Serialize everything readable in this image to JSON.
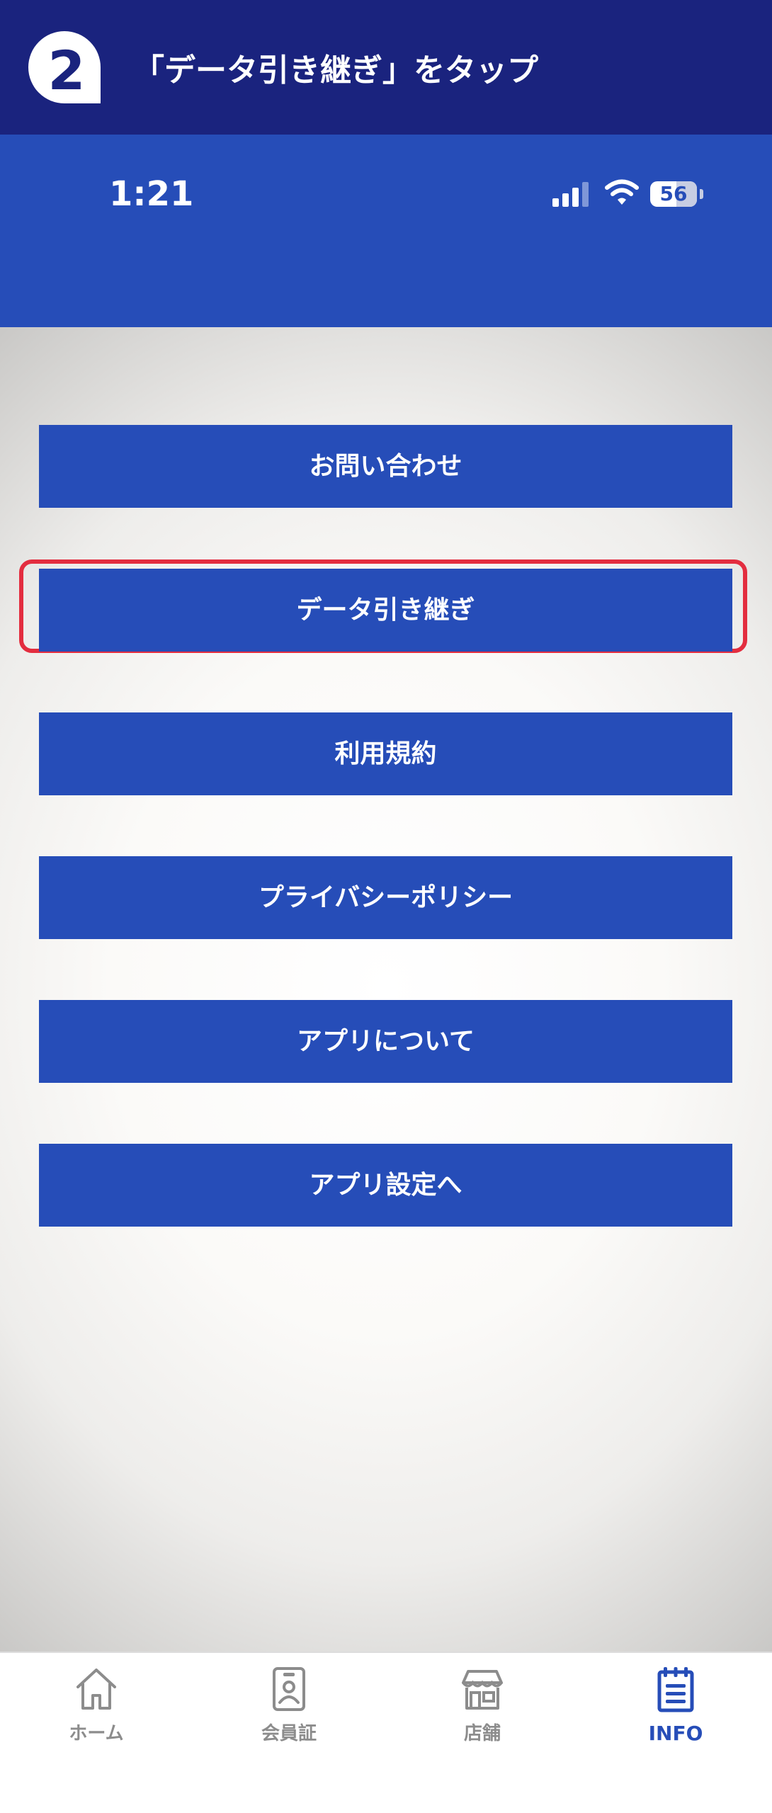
{
  "instruction_banner": {
    "title": "「データ引き継ぎ」をタップ",
    "logo_text": "2"
  },
  "status_bar": {
    "time": "1:21",
    "battery_level": "56",
    "icons": [
      "cellular-signal-icon",
      "wifi-icon",
      "battery-icon"
    ]
  },
  "menu": {
    "items": [
      {
        "label": "お問い合わせ"
      },
      {
        "label": "データ引き継ぎ",
        "highlighted": true
      },
      {
        "label": "利用規約"
      },
      {
        "label": "プライバシーポリシー"
      },
      {
        "label": "アプリについて"
      },
      {
        "label": "アプリ設定へ"
      }
    ]
  },
  "tab_bar": {
    "tabs": [
      {
        "label": "ホーム",
        "icon": "home-icon"
      },
      {
        "label": "会員証",
        "icon": "member-card-icon"
      },
      {
        "label": "店舗",
        "icon": "store-icon"
      },
      {
        "label": "INFO",
        "icon": "info-notepad-icon",
        "active": true
      }
    ]
  },
  "colors": {
    "banner": "#1a237e",
    "primary": "#264db8",
    "highlight": "#e32d3f",
    "tab_inactive": "#8c8c8c"
  }
}
